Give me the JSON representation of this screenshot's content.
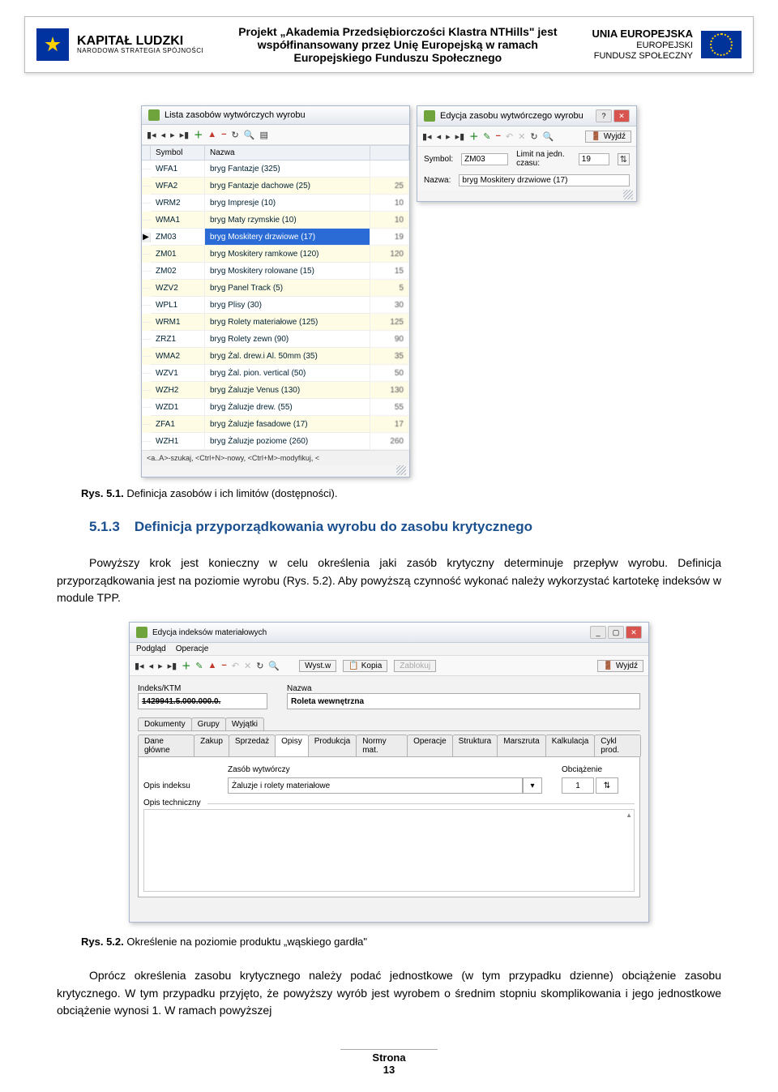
{
  "header": {
    "kapital_main": "KAPITAŁ LUDZKI",
    "kapital_sub": "NARODOWA STRATEGIA SPÓJNOŚCI",
    "center": "Projekt „Akademia Przedsiębiorczości Klastra NTHills\" jest współfinansowany przez Unię Europejską w ramach Europejskiego Funduszu Społecznego",
    "eu_main": "UNIA EUROPEJSKA",
    "eu_sub1": "EUROPEJSKI",
    "eu_sub2": "FUNDUSZ SPOŁECZNY"
  },
  "win_left": {
    "title": "Lista zasobów wytwórczych wyrobu",
    "col_sym": "Symbol",
    "col_name": "Nazwa",
    "status": "<a..A>-szukaj, <Ctrl+N>-nowy, <Ctrl+M>-modyfikuj, <",
    "rows": [
      {
        "sym": "WFA1",
        "name": "bryg Fantazje (325)",
        "val": ""
      },
      {
        "sym": "WFA2",
        "name": "bryg Fantazje dachowe (25)",
        "val": "25"
      },
      {
        "sym": "WRM2",
        "name": "bryg Impresje (10)",
        "val": "10"
      },
      {
        "sym": "WMA1",
        "name": "bryg Maty rzymskie (10)",
        "val": "10"
      },
      {
        "sym": "ZM03",
        "name": "bryg Moskitery drzwiowe (17)",
        "val": "19",
        "selected": true
      },
      {
        "sym": "ZM01",
        "name": "bryg Moskitery ramkowe (120)",
        "val": "120"
      },
      {
        "sym": "ZM02",
        "name": "bryg Moskitery rolowane (15)",
        "val": "15"
      },
      {
        "sym": "WZV2",
        "name": "bryg Panel Track (5)",
        "val": "5"
      },
      {
        "sym": "WPL1",
        "name": "bryg Plisy (30)",
        "val": "30"
      },
      {
        "sym": "WRM1",
        "name": "bryg Rolety materiałowe (125)",
        "val": "125"
      },
      {
        "sym": "ZRZ1",
        "name": "bryg Rolety zewn (90)",
        "val": "90"
      },
      {
        "sym": "WMA2",
        "name": "bryg Żal. drew.i Al. 50mm (35)",
        "val": "35"
      },
      {
        "sym": "WZV1",
        "name": "bryg Żal. pion. vertical (50)",
        "val": "50"
      },
      {
        "sym": "WZH2",
        "name": "bryg Żaluzje Venus (130)",
        "val": "130"
      },
      {
        "sym": "WZD1",
        "name": "bryg Żaluzje drew. (55)",
        "val": "55"
      },
      {
        "sym": "ZFA1",
        "name": "bryg Żaluzje fasadowe (17)",
        "val": "17"
      },
      {
        "sym": "WZH1",
        "name": "bryg Żaluzje poziome (260)",
        "val": "260"
      }
    ]
  },
  "win_right": {
    "title": "Edycja zasobu wytwórczego wyrobu",
    "wyjdz": "Wyjdź",
    "lbl_symbol": "Symbol:",
    "val_symbol": "ZM03",
    "lbl_limit": "Limit na jedn. czasu:",
    "val_limit": "19",
    "lbl_nazwa": "Nazwa:",
    "val_nazwa": "bryg Moskitery drzwiowe (17)"
  },
  "caption1_num": "Rys. 5.1.",
  "caption1_text": " Definicja zasobów i ich limitów (dostępności).",
  "heading_num": "5.1.3",
  "heading_text": "Definicja przyporządkowania wyrobu do zasobu krytycznego",
  "para1": "Powyższy krok jest konieczny w celu określenia jaki zasób krytyczny  determinuje przepływ wyrobu. Definicja przyporządkowania jest na poziomie wyrobu (Rys. 5.2).  Aby powyższą czynność wykonać należy wykorzystać kartotekę indeksów w module TPP.",
  "win2": {
    "title": "Edycja indeksów materiałowych",
    "menu1": "Podgląd",
    "menu2": "Operacje",
    "wyst": "Wyst.w",
    "kopia": "Kopia",
    "zablokuj": "Zablokuj",
    "wyjdz": "Wyjdź",
    "lbl_indeks": "Indeks/KTM",
    "val_indeks": "1429941.5.000.000.0.",
    "lbl_nazwa": "Nazwa",
    "val_nazwa": "Roleta wewnętrzna",
    "tabs1": [
      "Dokumenty",
      "Grupy",
      "Wyjątki"
    ],
    "tabs2": [
      "Dane główne",
      "Zakup",
      "Sprzedaż",
      "Opisy",
      "Produkcja",
      "Normy mat.",
      "Operacje",
      "Struktura",
      "Marszruta",
      "Kalkulacja",
      "Cykl prod."
    ],
    "active_tab2": 3,
    "lbl_zasob": "Zasób wytwórczy",
    "lbl_obc": "Obciążenie",
    "val_zasob": "Żaluzje i rolety materiałowe",
    "val_obc": "1",
    "lbl_opis_idx": "Opis indeksu",
    "lbl_opis_tech": "Opis techniczny"
  },
  "caption2_num": "Rys. 5.2.",
  "caption2_text": " Określenie na poziomie produktu „wąskiego gardła\"",
  "para2": "Oprócz określenia zasobu krytycznego należy podać jednostkowe (w tym przypadku dzienne) obciążenie zasobu krytycznego. W tym przypadku przyjęto, że powyższy wyrób jest wyrobem o średnim stopniu skomplikowania i jego jednostkowe obciążenie wynosi 1. W ramach powyższej",
  "footer_label": "Strona",
  "footer_num": "13"
}
